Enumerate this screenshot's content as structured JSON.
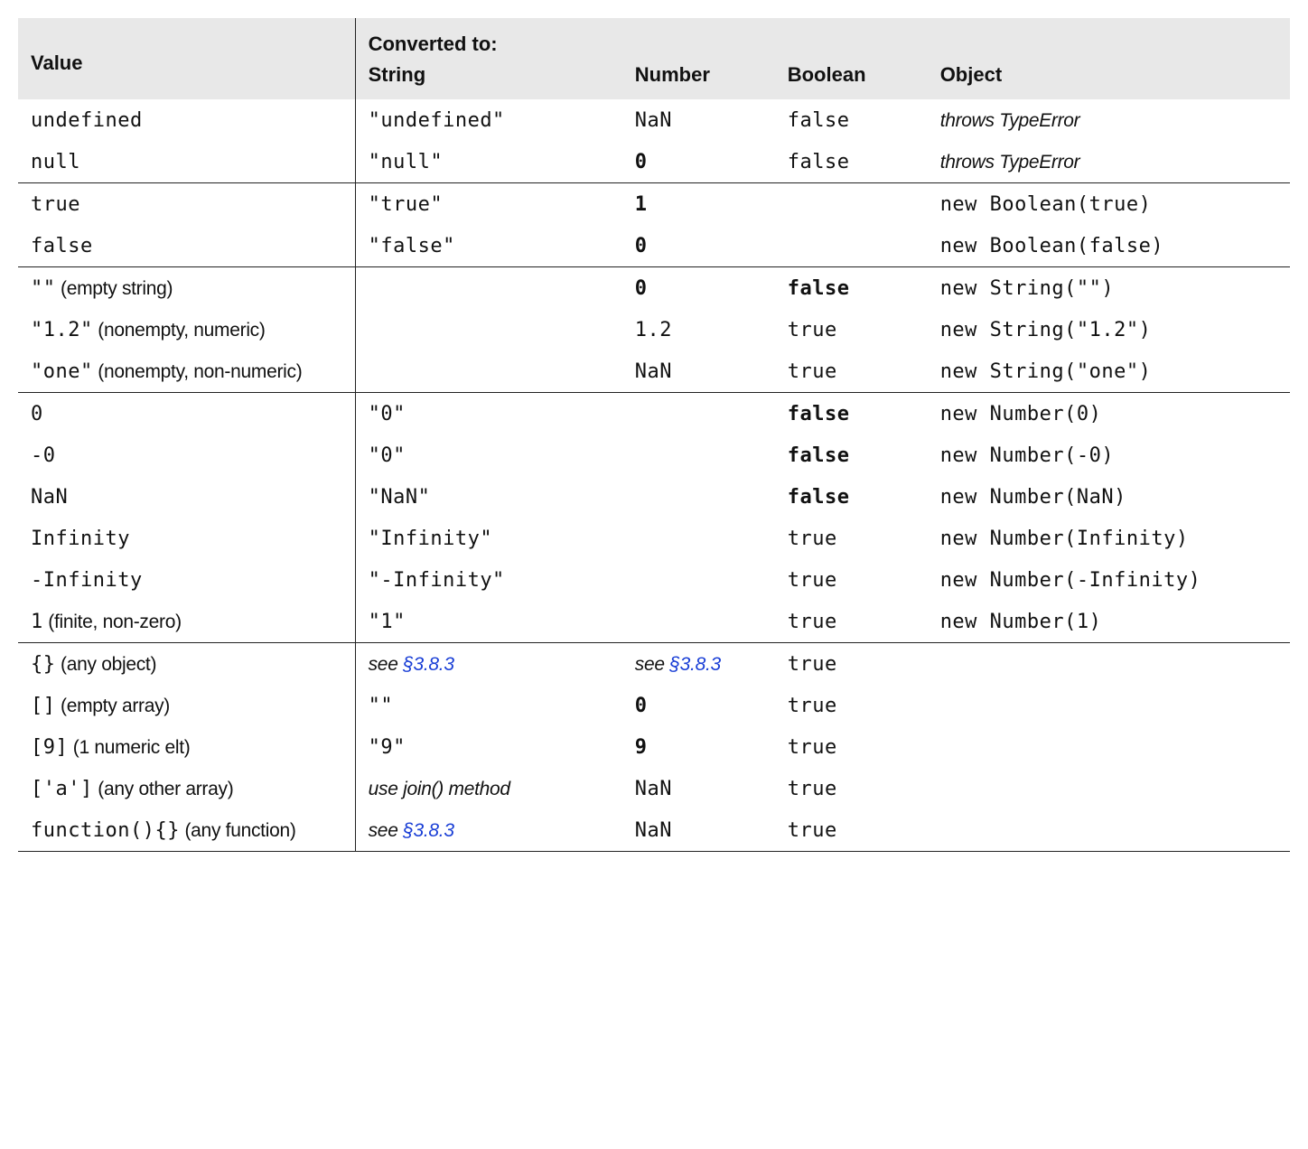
{
  "headers": {
    "value": "Value",
    "converted_to": "Converted to:",
    "string": "String",
    "number": "Number",
    "boolean": "Boolean",
    "object": "Object"
  },
  "labels": {
    "see_ref": "see ",
    "ref_section": "§3.8.3",
    "use_join": "use join() method",
    "throws_typeerror": "throws TypeError"
  },
  "groups": [
    [
      {
        "value_code": "undefined",
        "value_desc": "",
        "string_code": "\"undefined\"",
        "number_code": "NaN",
        "boolean_code": "false",
        "object_code": "",
        "object_throws": true
      },
      {
        "value_code": "null",
        "value_desc": "",
        "string_code": "\"null\"",
        "number_code": "0",
        "number_bold": true,
        "boolean_code": "false",
        "object_code": "",
        "object_throws": true
      }
    ],
    [
      {
        "value_code": "true",
        "value_desc": "",
        "string_code": "\"true\"",
        "number_code": "1",
        "number_bold": true,
        "boolean_code": "",
        "object_code": "new Boolean(true)"
      },
      {
        "value_code": "false",
        "value_desc": "",
        "string_code": "\"false\"",
        "number_code": "0",
        "number_bold": true,
        "boolean_code": "",
        "object_code": "new Boolean(false)"
      }
    ],
    [
      {
        "value_code": "\"\"",
        "value_desc": " (empty string)",
        "string_code": "",
        "number_code": "0",
        "number_bold": true,
        "boolean_code": "false",
        "boolean_bold": true,
        "object_code": "new String(\"\")"
      },
      {
        "value_code": "\"1.2\"",
        "value_desc": " (nonempty, numeric)",
        "string_code": "",
        "number_code": "1.2",
        "boolean_code": "true",
        "object_code": "new String(\"1.2\")"
      },
      {
        "value_code": "\"one\"",
        "value_desc": " (nonempty, non-numeric)",
        "string_code": "",
        "number_code": "NaN",
        "boolean_code": "true",
        "object_code": "new String(\"one\")"
      }
    ],
    [
      {
        "value_code": "0",
        "value_desc": "",
        "string_code": "\"0\"",
        "number_code": "",
        "boolean_code": "false",
        "boolean_bold": true,
        "object_code": "new Number(0)"
      },
      {
        "value_code": "-0",
        "value_desc": "",
        "string_code": "\"0\"",
        "number_code": "",
        "boolean_code": "false",
        "boolean_bold": true,
        "object_code": "new Number(-0)"
      },
      {
        "value_code": "NaN",
        "value_desc": "",
        "string_code": "\"NaN\"",
        "number_code": "",
        "boolean_code": "false",
        "boolean_bold": true,
        "object_code": "new Number(NaN)"
      },
      {
        "value_code": "Infinity",
        "value_desc": "",
        "string_code": "\"Infinity\"",
        "number_code": "",
        "boolean_code": "true",
        "object_code": "new Number(Infinity)"
      },
      {
        "value_code": "-Infinity",
        "value_desc": "",
        "string_code": "\"-Infinity\"",
        "number_code": "",
        "boolean_code": "true",
        "object_code": "new Number(-Infinity)"
      },
      {
        "value_code": "1",
        "value_desc": " (finite, non-zero)",
        "string_code": "\"1\"",
        "number_code": "",
        "boolean_code": "true",
        "object_code": "new Number(1)"
      }
    ],
    [
      {
        "value_code": "{}",
        "value_desc": " (any object)",
        "string_ref": true,
        "number_ref": true,
        "boolean_code": "true",
        "object_code": ""
      },
      {
        "value_code": "[]",
        "value_desc": " (empty array)",
        "string_code": "\"\"",
        "number_code": "0",
        "number_bold": true,
        "boolean_code": "true",
        "object_code": ""
      },
      {
        "value_code": "[9]",
        "value_desc": " (1 numeric elt)",
        "string_code": "\"9\"",
        "number_code": "9",
        "number_bold": true,
        "boolean_code": "true",
        "object_code": ""
      },
      {
        "value_code": "['a']",
        "value_desc": " (any other array)",
        "string_join": true,
        "number_code": "NaN",
        "boolean_code": "true",
        "object_code": ""
      },
      {
        "value_code": "function(){}",
        "value_desc": " (any function)",
        "string_ref": true,
        "number_code": "NaN",
        "boolean_code": "true",
        "object_code": ""
      }
    ]
  ]
}
